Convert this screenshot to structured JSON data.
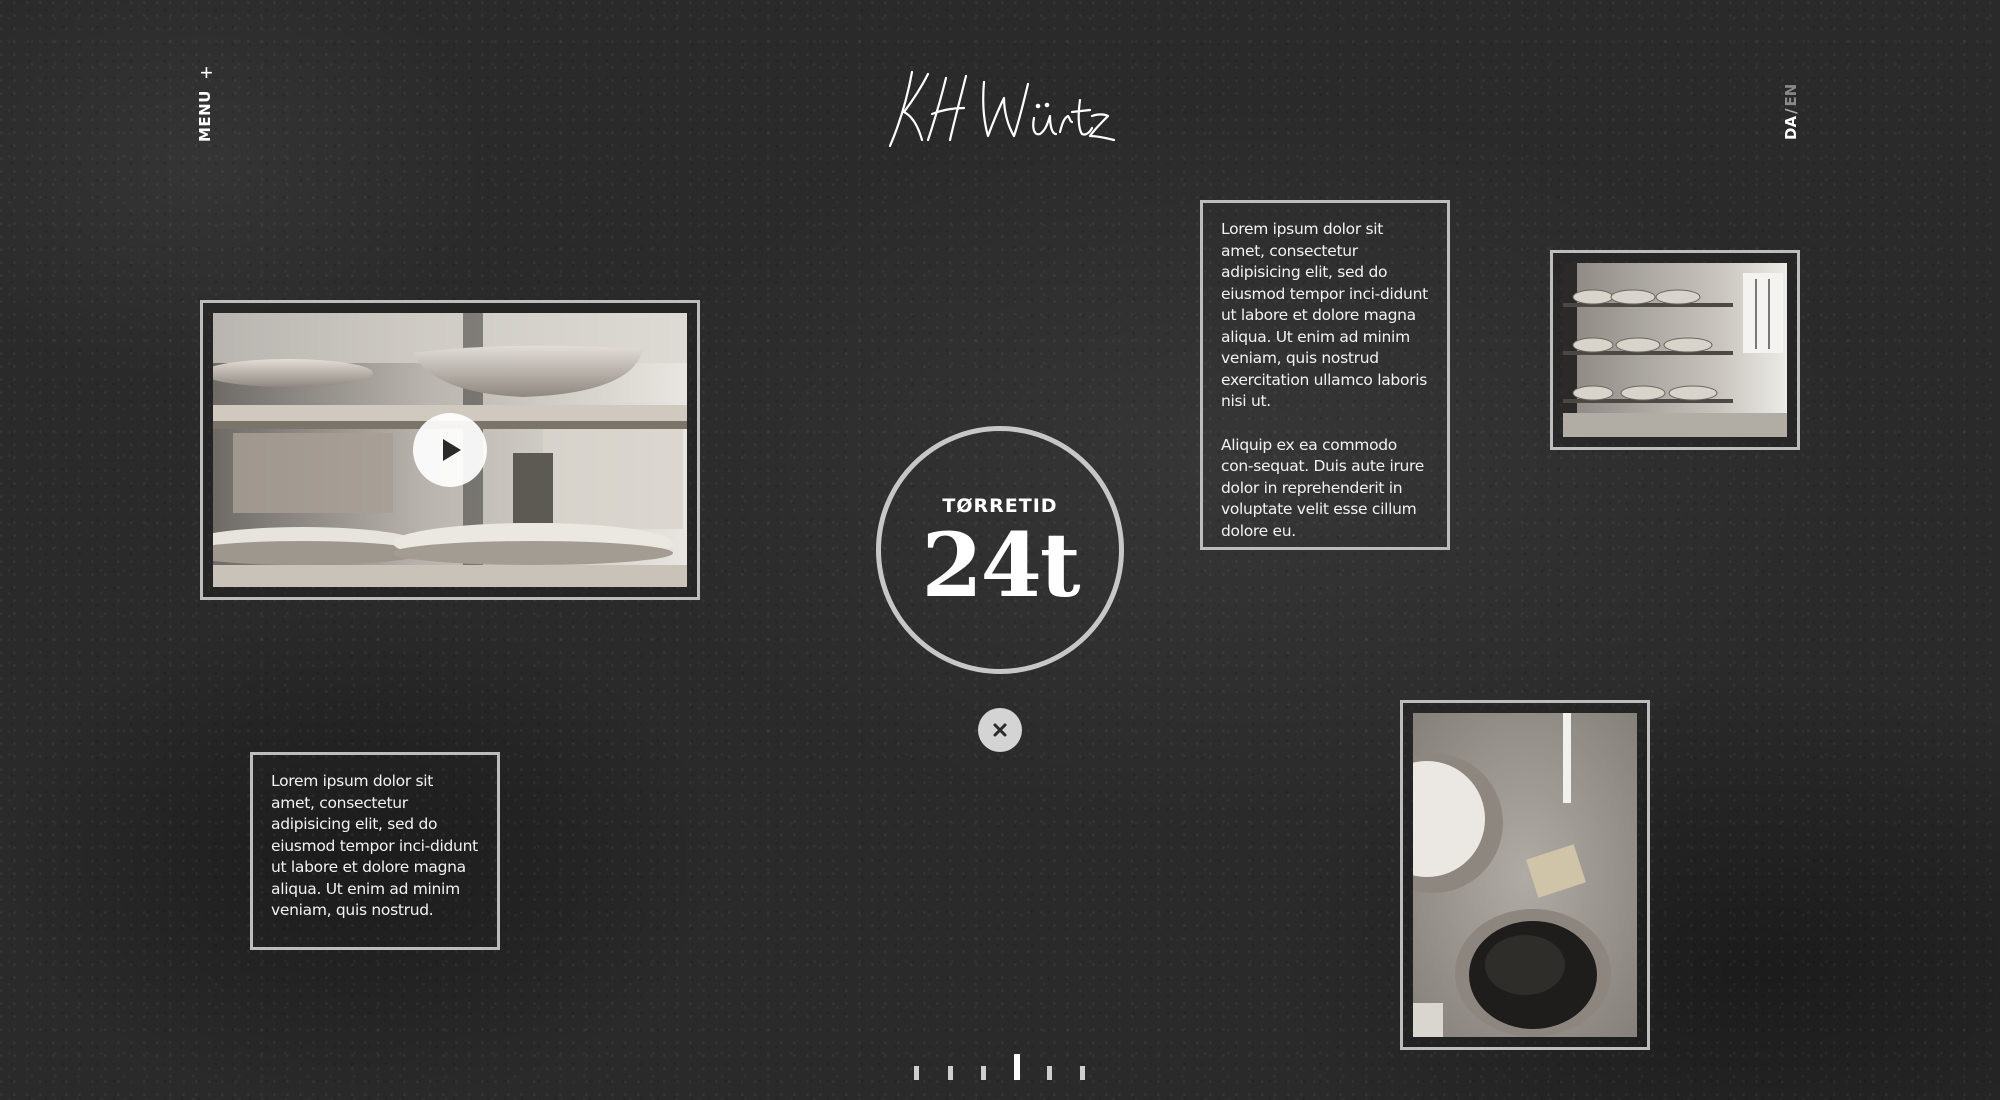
{
  "nav": {
    "menu_label": "MENU",
    "menu_icon": "plus-icon"
  },
  "brand": {
    "logo": "KH Würtz"
  },
  "language": {
    "active": "DA",
    "separator": "/",
    "inactive": "EN"
  },
  "stat": {
    "label": "TØRRETID",
    "value": "24t"
  },
  "text_blocks": {
    "right_p1": "Lorem ipsum dolor sit amet, consectetur adipisicing elit, sed do eiusmod tempor inci-didunt ut labore et dolore magna aliqua. Ut enim ad minim veniam, quis nostrud exercitation ullamco laboris nisi ut.",
    "right_p2": "Aliquip ex ea commodo con-sequat. Duis aute irure dolor in reprehenderit in voluptate velit esse cillum dolore eu.",
    "left_p1": "Lorem ipsum dolor sit amet, consectetur adipisicing elit, sed do eiusmod tempor inci-didunt ut labore et dolore magna aliqua. Ut enim ad minim veniam, quis nostrud."
  },
  "media": {
    "video_icon": "play-icon",
    "close_icon": "close-icon"
  },
  "pagination": {
    "total": 6,
    "active_index": 3
  },
  "colors": {
    "background": "#2a2a2a",
    "frame": "#bdbdbd",
    "text": "#ffffff"
  }
}
